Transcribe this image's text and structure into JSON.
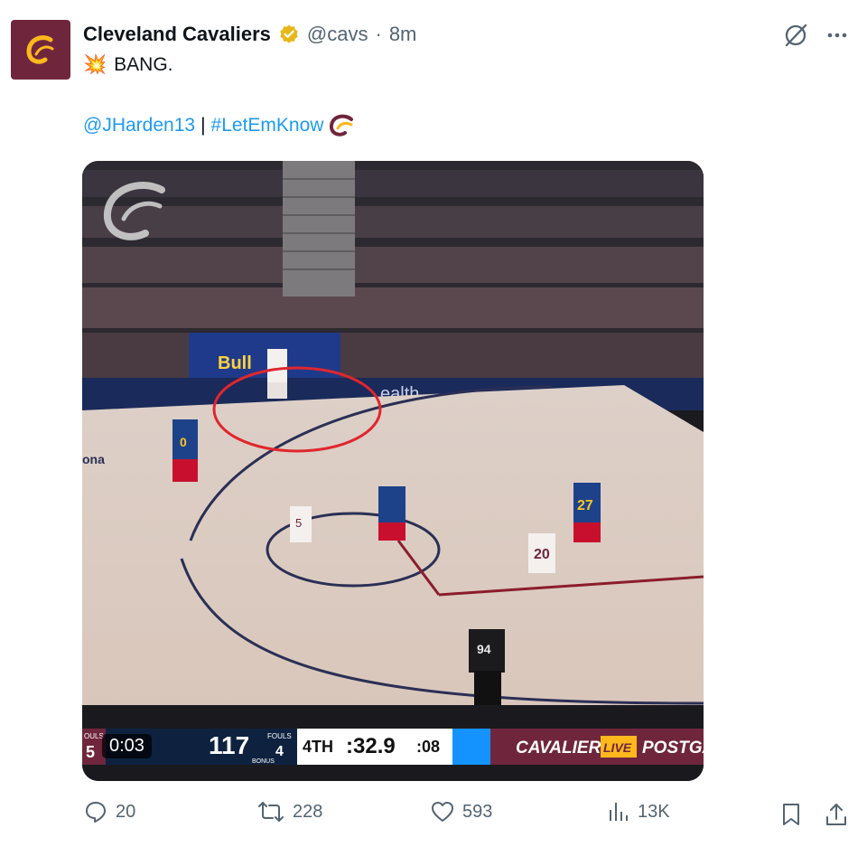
{
  "tweet": {
    "author_name": "Cleveland Cavaliers",
    "handle": "@cavs",
    "separator": "·",
    "time": "8m",
    "emoji": "💥",
    "text": "BANG.",
    "mention": "@JHarden13",
    "divider": "|",
    "hashtag": "#LetEmKnow"
  },
  "media": {
    "video_time": "0:03",
    "scorebug": {
      "away_fouls_label": "OULS",
      "away_fouls_partial": "5",
      "home_score": "117",
      "home_fouls_label": "FOULS",
      "home_fouls": "4",
      "bonus_label": "BONUS",
      "quarter": "4TH",
      "clock": ":32.9",
      "shot_clock": ":08",
      "banner": "CAVALIERS",
      "banner_live": "LIVE",
      "banner_tail": "POSTGA"
    },
    "jerseys": {
      "nuggets_left": "0",
      "cav_mid": "5",
      "cav_right": "20",
      "nuggets_right": "27",
      "referee": "94"
    },
    "arena_text": {
      "sponsor": "Bull",
      "sponsor2": "ealth",
      "court_left": "ona"
    }
  },
  "actions": {
    "replies": "20",
    "retweets": "228",
    "likes": "593",
    "views": "13K"
  },
  "colors": {
    "brand_wine": "#6f263d",
    "brand_gold": "#ffb81c",
    "link": "#1d9bf0",
    "muted": "#536471",
    "nuggets_blue": "#0e2240",
    "nuggets_gold": "#fec524"
  }
}
